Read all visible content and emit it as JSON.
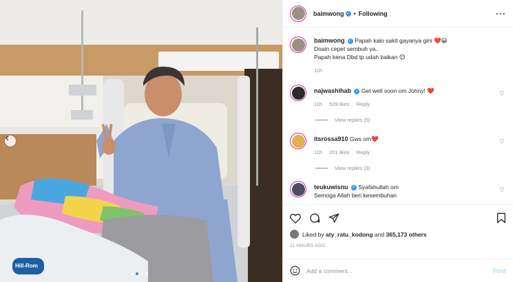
{
  "post": {
    "username": "baimwong",
    "follow_status": "Following",
    "caption_lines": [
      "Papah kalo sakit gayanya gini ❤️😀",
      "Doain cepet sembuh ya..",
      "Papah kena Dbd tp udah baikan 😊"
    ],
    "caption_time": "11h"
  },
  "comments": [
    {
      "username": "najwashihab",
      "verified": true,
      "text": "Get well soon om Johny! ❤️",
      "time": "11h",
      "likes": "529 likes",
      "reply": "Reply",
      "view_replies": "View replies (5)"
    },
    {
      "username": "itsrossa910",
      "verified": false,
      "text": "Gws om❤️",
      "time": "11h",
      "likes": "201 likes",
      "reply": "Reply",
      "view_replies": "View replies (3)"
    },
    {
      "username": "teukuwisnu",
      "verified": true,
      "text": "Syafahullah om",
      "text2": "Semoga Allah beri kesembuhan"
    }
  ],
  "likes": {
    "prefix": "Liked by",
    "user": "aty_ratu_kodong",
    "middle": "and",
    "others": "365,173 others"
  },
  "timestamp": "11 HOURS AGO",
  "add_comment": {
    "placeholder": "Add a comment...",
    "post_label": "Post"
  },
  "photo": {
    "bed_brand": "Hill-Rom"
  },
  "icons": [
    "more-icon",
    "heart-icon",
    "comment-icon",
    "share-icon",
    "save-icon",
    "emoji-icon",
    "chevron-left-icon",
    "verified-icon"
  ],
  "colors": {
    "verified": "#3897f0",
    "post_disabled": "#b2dffc",
    "muted": "#8e8e8e",
    "story_ring": "#d6249f",
    "carousel_active": "#2a8ae8"
  },
  "carousel": {
    "slide_count": 4,
    "active_index": 1
  }
}
